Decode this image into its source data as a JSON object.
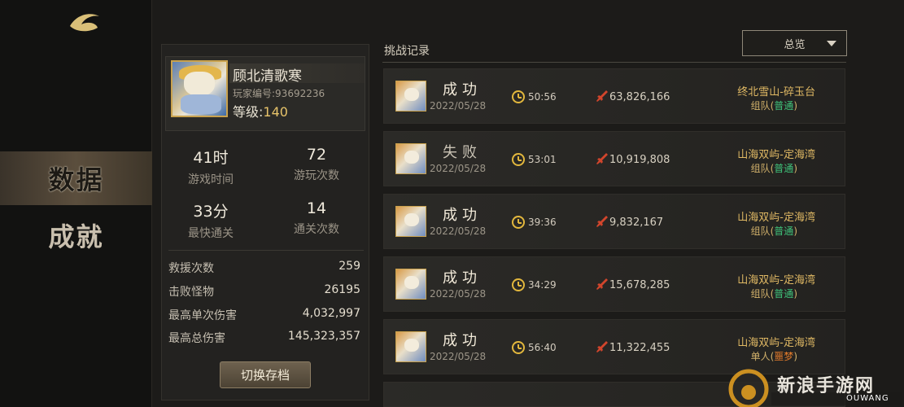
{
  "nav": {
    "items": [
      {
        "label": "数据",
        "active": true
      },
      {
        "label": "成就",
        "active": false
      }
    ]
  },
  "profile": {
    "name": "顾北清歌寒",
    "player_id": "玩家编号:93692236",
    "level_label": "等级:",
    "level_value": "140",
    "stats": [
      {
        "value": "41时",
        "label": "游戏时间"
      },
      {
        "value": "72",
        "label": "游玩次数"
      },
      {
        "value": "33分",
        "label": "最快通关"
      },
      {
        "value": "14",
        "label": "通关次数"
      }
    ],
    "details": [
      {
        "key": "救援次数",
        "value": "259"
      },
      {
        "key": "击败怪物",
        "value": "26195"
      },
      {
        "key": "最高单次伤害",
        "value": "4,032,997"
      },
      {
        "key": "最高总伤害",
        "value": "145,323,357"
      }
    ],
    "switch_label": "切换存档"
  },
  "records": {
    "title": "挑战记录",
    "filter": {
      "selected": "总览"
    },
    "items": [
      {
        "result": "成功",
        "date": "2022/05/28",
        "time": "50:56",
        "damage": "63,826,166",
        "place": "终北雪山-碎玉台",
        "mode": "组队",
        "difficulty": "普通"
      },
      {
        "result": "失败",
        "date": "2022/05/28",
        "time": "53:01",
        "damage": "10,919,808",
        "place": "山海双屿-定海湾",
        "mode": "组队",
        "difficulty": "普通"
      },
      {
        "result": "成功",
        "date": "2022/05/28",
        "time": "39:36",
        "damage": "9,832,167",
        "place": "山海双屿-定海湾",
        "mode": "组队",
        "difficulty": "普通"
      },
      {
        "result": "成功",
        "date": "2022/05/28",
        "time": "34:29",
        "damage": "15,678,285",
        "place": "山海双屿-定海湾",
        "mode": "组队",
        "difficulty": "普通"
      },
      {
        "result": "成功",
        "date": "2022/05/28",
        "time": "56:40",
        "damage": "11,322,455",
        "place": "山海双屿-定海湾",
        "mode": "单人",
        "difficulty": "噩梦"
      }
    ]
  },
  "watermark": {
    "text": "新浪手游网",
    "sub": "OUWANG"
  },
  "colors": {
    "accent_gold": "#e2b73d",
    "difficulty_normal": "#3fc27a",
    "difficulty_hard": "#e07a2a"
  }
}
